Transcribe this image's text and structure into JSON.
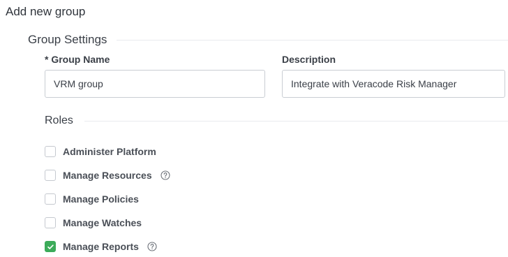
{
  "page": {
    "title": "Add new group"
  },
  "group_settings": {
    "section_label": "Group Settings",
    "group_name": {
      "label": "* Group Name",
      "value": "VRM group",
      "placeholder": ""
    },
    "description": {
      "label": "Description",
      "value": "Integrate with Veracode Risk Manager",
      "placeholder": ""
    }
  },
  "roles": {
    "section_label": "Roles",
    "items": [
      {
        "label": "Administer Platform",
        "checked": false,
        "help": false
      },
      {
        "label": "Manage Resources",
        "checked": false,
        "help": true
      },
      {
        "label": "Manage Policies",
        "checked": false,
        "help": false
      },
      {
        "label": "Manage Watches",
        "checked": false,
        "help": false
      },
      {
        "label": "Manage Reports",
        "checked": true,
        "help": true
      }
    ]
  },
  "colors": {
    "checkbox_checked": "#3cab5a",
    "input_border": "#c9cdd3",
    "divider": "#e9ebee"
  },
  "icons": {
    "help": "question-circle-icon",
    "check": "check-icon"
  }
}
